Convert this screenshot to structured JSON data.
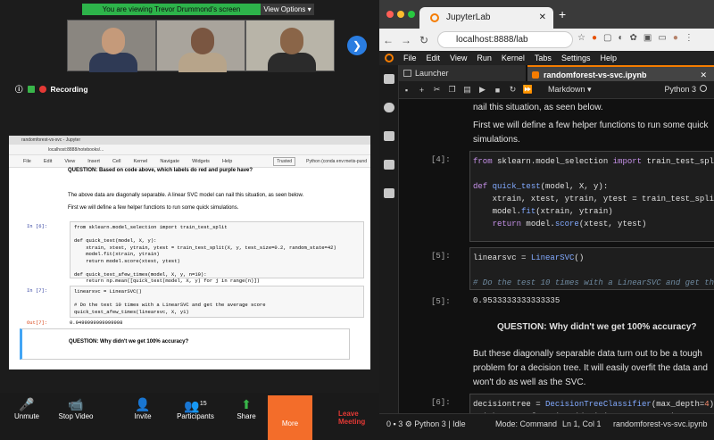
{
  "zoom": {
    "banner": "You are viewing Trevor Drummond's screen",
    "view_options": "View Options ▾",
    "recording": "Recording",
    "shared": {
      "tabs": "randomforest-vs-svc - Jupyter",
      "url": "localhost:8888/notebooks/...",
      "menu": [
        "File",
        "Edit",
        "View",
        "Insert",
        "Cell",
        "Kernel",
        "Navigate",
        "Widgets",
        "Help"
      ],
      "trusted": "Trusted",
      "kernel": "Python (conda env:metis-pund",
      "question1": "QUESTION: Based on code above, which labels do red and purple have?",
      "text1": "The above data are diagonally separable. A linear SVC model can nail this situation, as seen below.",
      "text2": "First we will define a few helper functions to run some quick simulations.",
      "p6": "In [6]:",
      "code6": "from sklearn.model_selection import train_test_split\n\ndef quick_test(model, X, y):\n    xtrain, xtest, ytrain, ytest = train_test_split(X, y, test_size=0.2, random_state=42)\n    model.fit(xtrain, ytrain)\n    return model.score(xtest, ytest)\n\ndef quick_test_afew_times(model, X, y, n=10):\n    return np.mean([quick_test(model, X, y) for j in range(n)])",
      "p7": "In [7]:",
      "code7": "linearsvc = LinearSVC()\n\n# Do the test 10 times with a LinearSVC and get the average score\nquick_test_afew_times(linearsvc, X, y1)",
      "o7": "Out[7]:",
      "out7": "0.9499999999999998",
      "question2": "QUESTION: Why didn't we get 100% accuracy?"
    },
    "controls": [
      {
        "label": "Unmute",
        "icon": "🎤"
      },
      {
        "label": "Stop Video",
        "icon": "📹"
      },
      {
        "label": "Invite",
        "icon": "👤"
      },
      {
        "label": "Participants",
        "icon": "👥",
        "count": "15"
      },
      {
        "label": "Share",
        "icon": "⬆"
      }
    ],
    "more": "More",
    "leave": "Leave Meeting"
  },
  "browser": {
    "tab_title": "JupyterLab",
    "url": "localhost:8888/lab",
    "menu": [
      "File",
      "Edit",
      "View",
      "Run",
      "Kernel",
      "Tabs",
      "Settings",
      "Help"
    ],
    "tab_launcher": "Launcher",
    "tab_notebook": "randomforest-vs-svc.ipynb",
    "cell_type": "Markdown",
    "kernel": "Python 3"
  },
  "notebook": {
    "md1": "nail this situation, as seen below.",
    "md2": "First we will define a few helper functions to run some quick simulations.",
    "p4": "[4]:",
    "p5": "[5]:",
    "o5": "[5]:",
    "out5": "0.9533333333333335",
    "question": "QUESTION: Why didn't we get 100% accuracy?",
    "md3": "But these diagonally separable data turn out to be a tough problem for a decision tree. It will easily overfit the data and won't do as well as the SVC.",
    "p6": "[6]:"
  },
  "status": {
    "left": "0 ▪ 3 ⚙ Python 3 | Idle",
    "mode": "Mode: Command",
    "pos": "Ln 1, Col 1",
    "file": "randomforest-vs-svc.ipynb"
  },
  "colors": {
    "accent": "#f57c00",
    "zoom_green": "#2db34a",
    "zoom_more": "#f36d2a"
  }
}
